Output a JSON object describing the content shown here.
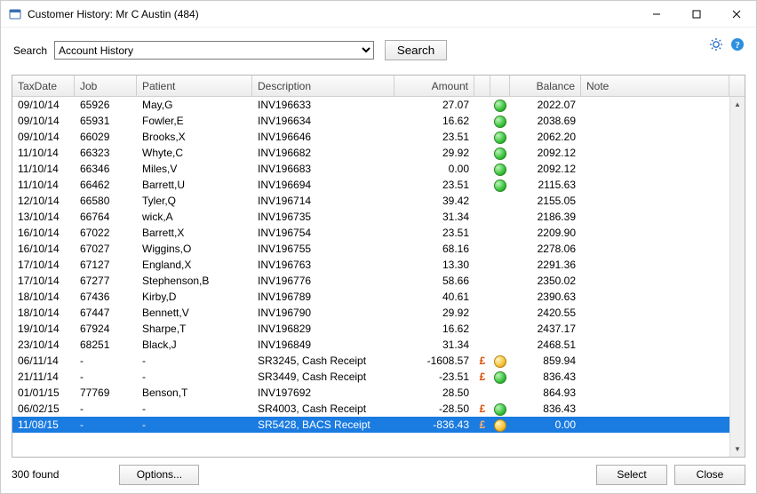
{
  "window": {
    "title": "Customer History: Mr C Austin (484)"
  },
  "search": {
    "label": "Search",
    "selected": "Account History",
    "button": "Search"
  },
  "columns": {
    "taxdate": "TaxDate",
    "job": "Job",
    "patient": "Patient",
    "description": "Description",
    "amount": "Amount",
    "balance": "Balance",
    "note": "Note"
  },
  "rows": [
    {
      "date": "09/10/14",
      "job": "65926",
      "patient": "May,G",
      "desc": "INV196633",
      "pound": "",
      "amount": "27.07",
      "status": "green",
      "balance": "2022.07",
      "note": ""
    },
    {
      "date": "09/10/14",
      "job": "65931",
      "patient": "Fowler,E",
      "desc": "INV196634",
      "pound": "",
      "amount": "16.62",
      "status": "green",
      "balance": "2038.69",
      "note": ""
    },
    {
      "date": "09/10/14",
      "job": "66029",
      "patient": "Brooks,X",
      "desc": "INV196646",
      "pound": "",
      "amount": "23.51",
      "status": "green",
      "balance": "2062.20",
      "note": ""
    },
    {
      "date": "11/10/14",
      "job": "66323",
      "patient": "Whyte,C",
      "desc": "INV196682",
      "pound": "",
      "amount": "29.92",
      "status": "green",
      "balance": "2092.12",
      "note": ""
    },
    {
      "date": "11/10/14",
      "job": "66346",
      "patient": "Miles,V",
      "desc": "INV196683",
      "pound": "",
      "amount": "0.00",
      "status": "green",
      "balance": "2092.12",
      "note": ""
    },
    {
      "date": "11/10/14",
      "job": "66462",
      "patient": "Barrett,U",
      "desc": "INV196694",
      "pound": "",
      "amount": "23.51",
      "status": "green",
      "balance": "2115.63",
      "note": ""
    },
    {
      "date": "12/10/14",
      "job": "66580",
      "patient": "Tyler,Q",
      "desc": "INV196714",
      "pound": "",
      "amount": "39.42",
      "status": "",
      "balance": "2155.05",
      "note": ""
    },
    {
      "date": "13/10/14",
      "job": "66764",
      "patient": "wick,A",
      "desc": "INV196735",
      "pound": "",
      "amount": "31.34",
      "status": "",
      "balance": "2186.39",
      "note": ""
    },
    {
      "date": "16/10/14",
      "job": "67022",
      "patient": "Barrett,X",
      "desc": "INV196754",
      "pound": "",
      "amount": "23.51",
      "status": "",
      "balance": "2209.90",
      "note": ""
    },
    {
      "date": "16/10/14",
      "job": "67027",
      "patient": "Wiggins,O",
      "desc": "INV196755",
      "pound": "",
      "amount": "68.16",
      "status": "",
      "balance": "2278.06",
      "note": ""
    },
    {
      "date": "17/10/14",
      "job": "67127",
      "patient": "England,X",
      "desc": "INV196763",
      "pound": "",
      "amount": "13.30",
      "status": "",
      "balance": "2291.36",
      "note": ""
    },
    {
      "date": "17/10/14",
      "job": "67277",
      "patient": "Stephenson,B",
      "desc": "INV196776",
      "pound": "",
      "amount": "58.66",
      "status": "",
      "balance": "2350.02",
      "note": ""
    },
    {
      "date": "18/10/14",
      "job": "67436",
      "patient": "Kirby,D",
      "desc": "INV196789",
      "pound": "",
      "amount": "40.61",
      "status": "",
      "balance": "2390.63",
      "note": ""
    },
    {
      "date": "18/10/14",
      "job": "67447",
      "patient": "Bennett,V",
      "desc": "INV196790",
      "pound": "",
      "amount": "29.92",
      "status": "",
      "balance": "2420.55",
      "note": ""
    },
    {
      "date": "19/10/14",
      "job": "67924",
      "patient": "Sharpe,T",
      "desc": "INV196829",
      "pound": "",
      "amount": "16.62",
      "status": "",
      "balance": "2437.17",
      "note": ""
    },
    {
      "date": "23/10/14",
      "job": "68251",
      "patient": "Black,J",
      "desc": "INV196849",
      "pound": "",
      "amount": "31.34",
      "status": "",
      "balance": "2468.51",
      "note": ""
    },
    {
      "date": "06/11/14",
      "job": "-",
      "patient": "-",
      "desc": "SR3245, Cash Receipt",
      "pound": "£",
      "amount": "-1608.57",
      "status": "amber",
      "balance": "859.94",
      "note": ""
    },
    {
      "date": "21/11/14",
      "job": "-",
      "patient": "-",
      "desc": "SR3449, Cash Receipt",
      "pound": "£",
      "amount": "-23.51",
      "status": "green",
      "balance": "836.43",
      "note": ""
    },
    {
      "date": "01/01/15",
      "job": "77769",
      "patient": "Benson,T",
      "desc": "INV197692",
      "pound": "",
      "amount": "28.50",
      "status": "",
      "balance": "864.93",
      "note": ""
    },
    {
      "date": "06/02/15",
      "job": "-",
      "patient": "-",
      "desc": "SR4003, Cash Receipt",
      "pound": "£",
      "amount": "-28.50",
      "status": "green",
      "balance": "836.43",
      "note": ""
    },
    {
      "date": "11/08/15",
      "job": "-",
      "patient": "-",
      "desc": "SR5428, BACS Receipt",
      "pound": "£",
      "amount": "-836.43",
      "status": "amber",
      "balance": "0.00",
      "note": "",
      "selected": true
    }
  ],
  "footer": {
    "status": "300  found",
    "options": "Options...",
    "select": "Select",
    "close": "Close"
  }
}
